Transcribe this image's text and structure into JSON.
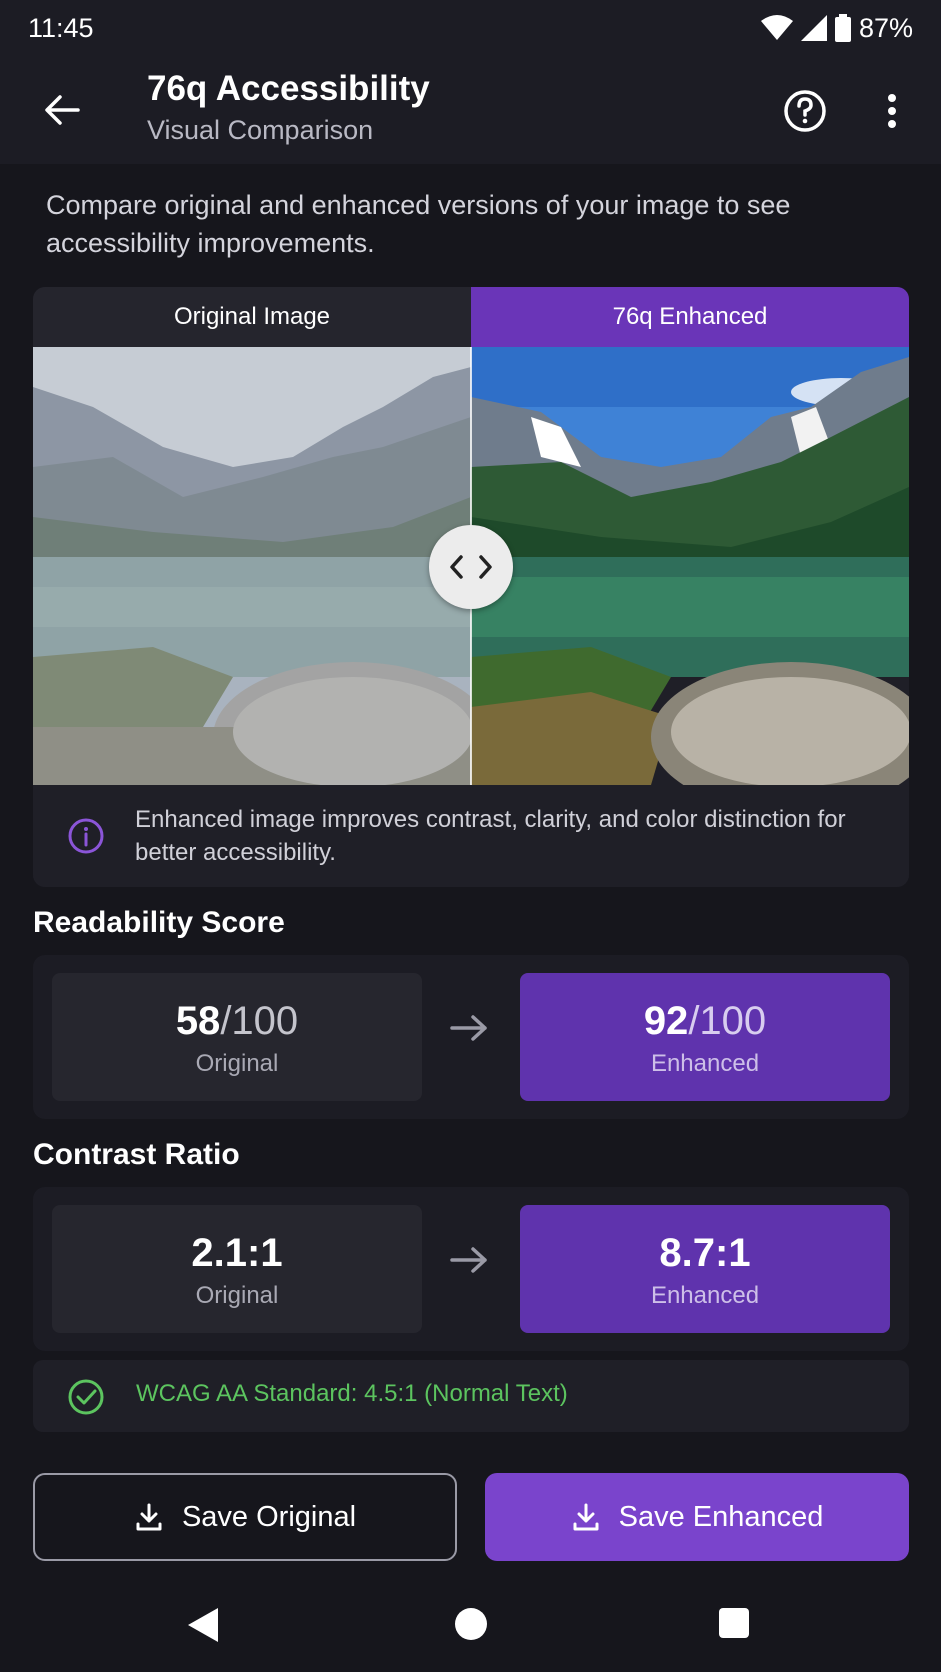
{
  "status_bar": {
    "time": "11:45",
    "battery": "87%"
  },
  "app_bar": {
    "title": "76q Accessibility",
    "subtitle": "Visual Comparison"
  },
  "intro": "Compare original and enhanced versions of your image to see accessibility improvements.",
  "comparison": {
    "tab_original": "Original Image",
    "tab_enhanced": "76q Enhanced",
    "info": "Enhanced image improves contrast, clarity, and color distinction for better accessibility."
  },
  "readability": {
    "title": "Readability Score",
    "original_value": "58",
    "original_denom": "/100",
    "original_label": "Original",
    "enhanced_value": "92",
    "enhanced_denom": "/100",
    "enhanced_label": "Enhanced"
  },
  "contrast": {
    "title": "Contrast Ratio",
    "original_value": "2.1:1",
    "original_label": "Original",
    "enhanced_value": "8.7:1",
    "enhanced_label": "Enhanced"
  },
  "wcag": {
    "text": "WCAG AA Standard: 4.5:1 (Normal Text)"
  },
  "buttons": {
    "save_original": "Save Original",
    "save_enhanced": "Save Enhanced"
  },
  "colors": {
    "accent": "#7a44cc",
    "tab_accent": "#6a35b8",
    "success": "#5cc45f",
    "background": "#16161c"
  },
  "icons": [
    "back-arrow-icon",
    "help-icon",
    "more-vert-icon",
    "compare-arrows-icon",
    "info-icon",
    "arrow-right-icon",
    "check-circle-icon",
    "download-icon",
    "nav-back-icon",
    "nav-home-icon",
    "nav-recents-icon"
  ]
}
